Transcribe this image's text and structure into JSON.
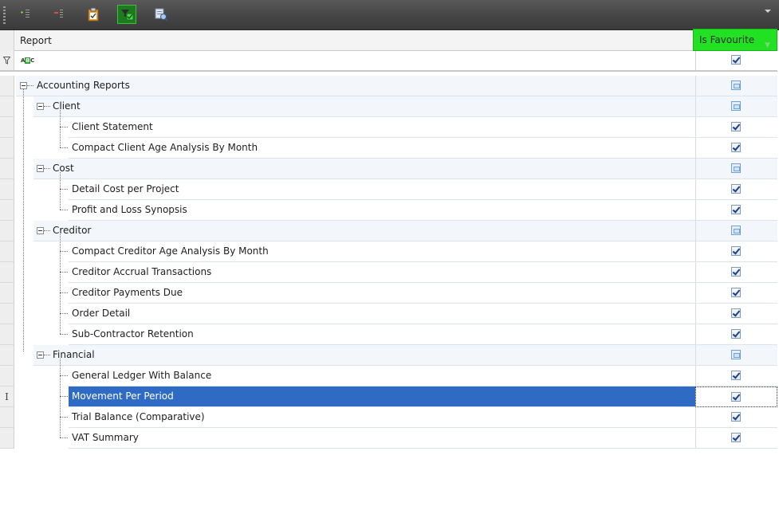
{
  "toolbar": {
    "buttons": [
      {
        "icon": "add-row-icon",
        "name": "add-button"
      },
      {
        "icon": "remove-row-icon",
        "name": "remove-button"
      },
      {
        "icon": "clipboard-icon",
        "name": "clipboard-button"
      },
      {
        "icon": "favourite-filter-icon",
        "name": "filter-favourites-button",
        "active": true
      },
      {
        "icon": "preview-report-icon",
        "name": "preview-button"
      }
    ]
  },
  "grid": {
    "columns": {
      "report": "Report",
      "favourite": "Is Favourite"
    },
    "filter_row_icon": "funnel-icon",
    "rows": [
      {
        "label": "Accounting Reports",
        "level": 0,
        "group": true,
        "fav": "mixed"
      },
      {
        "label": "Client",
        "level": 1,
        "group": true,
        "fav": "mixed"
      },
      {
        "label": "Client Statement",
        "level": 2,
        "group": false,
        "fav": "checked"
      },
      {
        "label": "Compact Client Age Analysis By Month",
        "level": 2,
        "group": false,
        "fav": "checked"
      },
      {
        "label": "Cost",
        "level": 1,
        "group": true,
        "fav": "mixed"
      },
      {
        "label": "Detail Cost per Project",
        "level": 2,
        "group": false,
        "fav": "checked"
      },
      {
        "label": "Profit and Loss Synopsis",
        "level": 2,
        "group": false,
        "fav": "checked"
      },
      {
        "label": "Creditor",
        "level": 1,
        "group": true,
        "fav": "mixed"
      },
      {
        "label": "Compact Creditor Age Analysis By Month",
        "level": 2,
        "group": false,
        "fav": "checked"
      },
      {
        "label": "Creditor Accrual Transactions",
        "level": 2,
        "group": false,
        "fav": "checked"
      },
      {
        "label": "Creditor Payments Due",
        "level": 2,
        "group": false,
        "fav": "checked"
      },
      {
        "label": "Order Detail",
        "level": 2,
        "group": false,
        "fav": "checked"
      },
      {
        "label": "Sub-Contractor Retention",
        "level": 2,
        "group": false,
        "fav": "checked"
      },
      {
        "label": "Financial",
        "level": 1,
        "group": true,
        "fav": "mixed"
      },
      {
        "label": "General Ledger With Balance",
        "level": 2,
        "group": false,
        "fav": "checked"
      },
      {
        "label": "Movement Per Period",
        "level": 2,
        "group": false,
        "fav": "checked",
        "selected": true
      },
      {
        "label": "Trial Balance (Comparative)",
        "level": 2,
        "group": false,
        "fav": "checked"
      },
      {
        "label": "VAT Summary",
        "level": 2,
        "group": false,
        "fav": "checked"
      }
    ]
  },
  "colors": {
    "selection": "#2f6bc4",
    "favourite_header": "#22e022",
    "toolbar": "#4a4a4a"
  }
}
